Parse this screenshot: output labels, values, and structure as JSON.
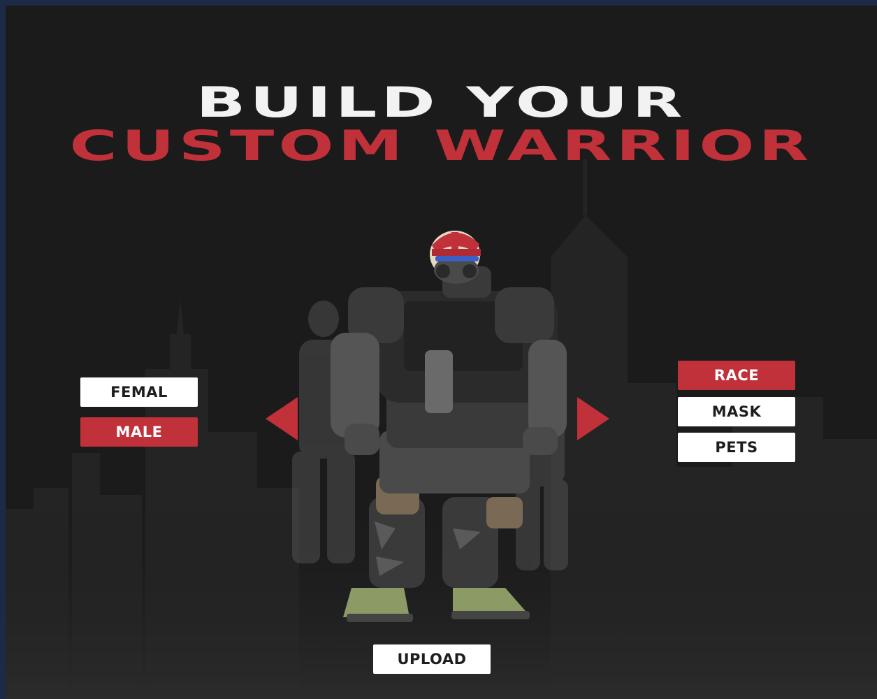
{
  "heading": {
    "line1": "BUILD YOUR",
    "line2": "CUSTOM WARRIOR"
  },
  "gender": {
    "options": [
      {
        "label": "FEMAL",
        "selected": false
      },
      {
        "label": "MALE",
        "selected": true
      }
    ]
  },
  "categories": {
    "options": [
      {
        "label": "RACE",
        "selected": true
      },
      {
        "label": "MASK",
        "selected": false
      },
      {
        "label": "PETS",
        "selected": false
      }
    ]
  },
  "actions": {
    "upload_label": "UPLOAD"
  },
  "navigation": {
    "prev_icon": "arrow-left-icon",
    "next_icon": "arrow-right-icon"
  },
  "colors": {
    "accent": "#c0313a",
    "background": "#1b1b1c",
    "button_light": "#ffffff",
    "heading_light": "#f2f2f2"
  }
}
